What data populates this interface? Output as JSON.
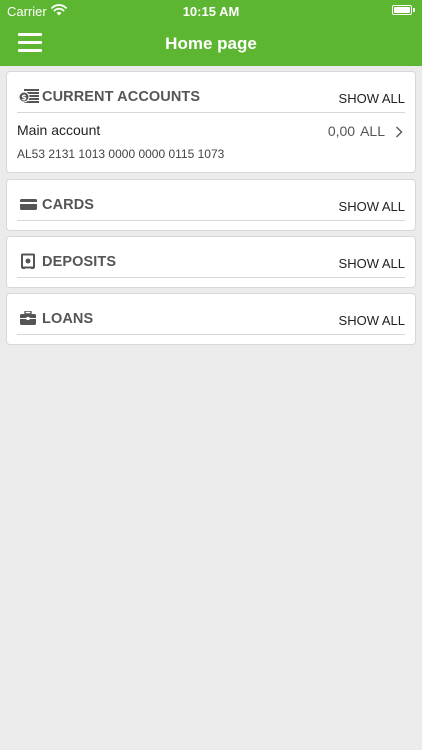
{
  "status_bar": {
    "carrier": "Carrier",
    "time": "10:15 AM"
  },
  "nav": {
    "title": "Home page",
    "menu_icon": "hamburger-menu-icon"
  },
  "sections": {
    "current_accounts": {
      "title": "CURRENT ACCOUNTS",
      "show_all": "SHOW ALL",
      "icon": "money-icon",
      "accounts": [
        {
          "name": "Main account",
          "iban": "AL53 2131 1013 0000 0000 0115 1073",
          "amount": "0,00",
          "currency": "ALL"
        }
      ]
    },
    "cards": {
      "title": "CARDS",
      "show_all": "SHOW ALL",
      "icon": "card-icon"
    },
    "deposits": {
      "title": "DEPOSITS",
      "show_all": "SHOW ALL",
      "icon": "safe-icon"
    },
    "loans": {
      "title": "LOANS",
      "show_all": "SHOW ALL",
      "icon": "briefcase-icon"
    }
  },
  "colors": {
    "brand": "#5db631",
    "background": "#ebebeb",
    "heading": "#555555"
  }
}
